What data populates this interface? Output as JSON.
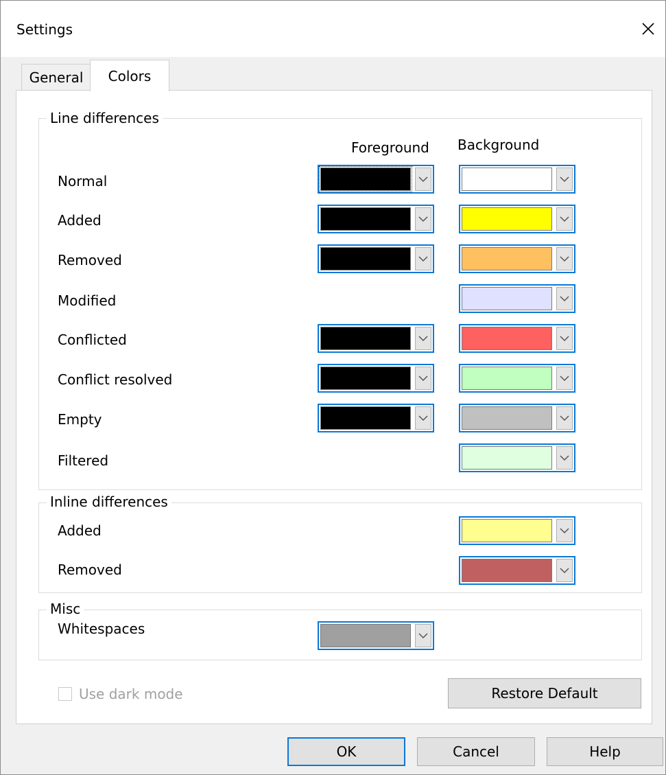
{
  "window": {
    "title": "Settings"
  },
  "tabs": [
    {
      "label": "General",
      "selected": false
    },
    {
      "label": "Colors",
      "selected": true
    }
  ],
  "line_differences": {
    "title": "Line differences",
    "foreground_header": "Foreground",
    "background_header": "Background",
    "rows": [
      {
        "label": "Normal",
        "foreground": "#000000",
        "background": "#ffffff"
      },
      {
        "label": "Added",
        "foreground": "#000000",
        "background": "#ffff00"
      },
      {
        "label": "Removed",
        "foreground": "#000000",
        "background": "#ffc060"
      },
      {
        "label": "Modified",
        "foreground": null,
        "background": "#e0e0ff"
      },
      {
        "label": "Conflicted",
        "foreground": "#000000",
        "background": "#ff6060"
      },
      {
        "label": "Conflict resolved",
        "foreground": "#000000",
        "background": "#c0ffc0"
      },
      {
        "label": "Empty",
        "foreground": "#000000",
        "background": "#c0c0c0"
      },
      {
        "label": "Filtered",
        "foreground": null,
        "background": "#e0ffe0"
      }
    ]
  },
  "inline_differences": {
    "title": "Inline differences",
    "rows": [
      {
        "label": "Added",
        "color": "#ffff90"
      },
      {
        "label": "Removed",
        "color": "#c06060"
      }
    ]
  },
  "misc": {
    "title": "Misc",
    "whitespaces_label": "Whitespaces",
    "whitespaces_color": "#a0a0a0"
  },
  "dark_mode": {
    "label": "Use dark mode",
    "checked": false,
    "enabled": false
  },
  "buttons": {
    "restore_default": "Restore Default",
    "ok": "OK",
    "cancel": "Cancel",
    "help": "Help"
  }
}
